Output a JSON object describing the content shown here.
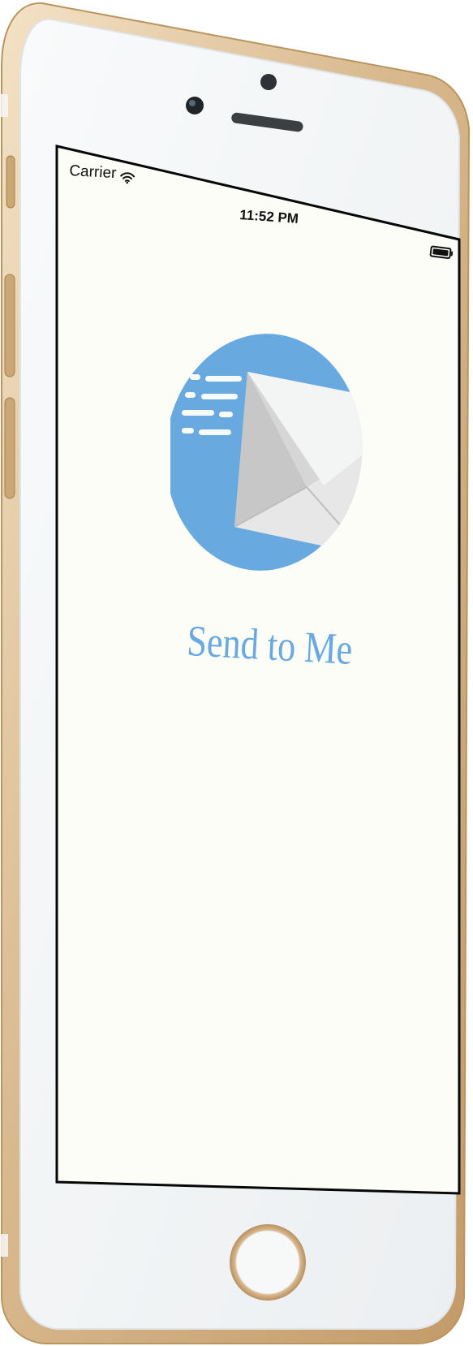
{
  "status_bar": {
    "carrier": "Carrier",
    "time": "11:52 PM",
    "wifi_icon": "wifi-icon",
    "battery_icon": "battery-icon"
  },
  "app": {
    "title": "Send to Me",
    "logo_icon": "envelope-send-icon"
  },
  "colors": {
    "accent_blue": "#6aa9e0",
    "screen_background": "#fdfdf8",
    "phone_gold": "#d8b88d"
  }
}
